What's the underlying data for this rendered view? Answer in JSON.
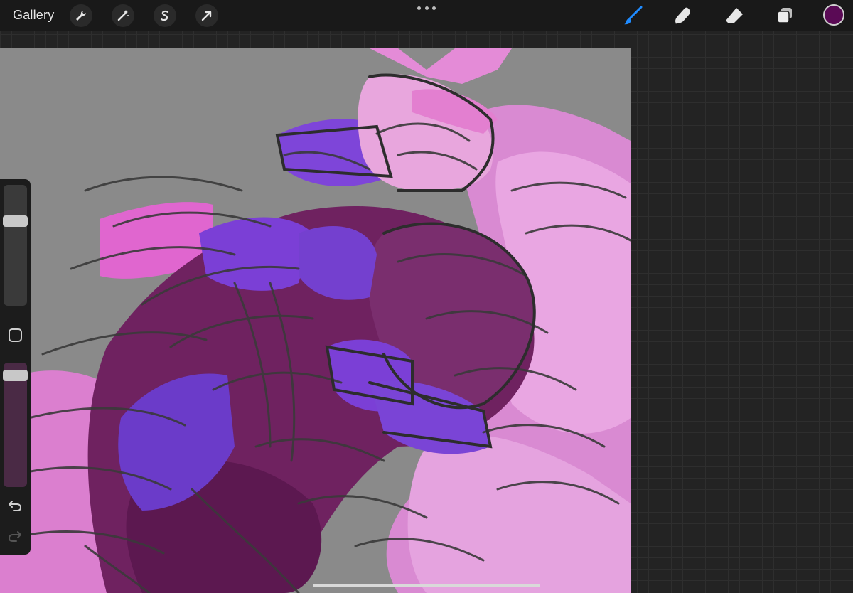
{
  "app": {
    "gallery_label": "Gallery"
  },
  "toolbar_left": [
    {
      "name": "actions",
      "icon": "wrench-icon"
    },
    {
      "name": "adjustments",
      "icon": "magic-wand-icon"
    },
    {
      "name": "selection",
      "icon": "selection-s-icon"
    },
    {
      "name": "transform",
      "icon": "arrow-cursor-icon"
    }
  ],
  "toolbar_right": [
    {
      "name": "brush",
      "icon": "brush-icon",
      "active": true,
      "color": "#1f8bff"
    },
    {
      "name": "smudge",
      "icon": "smudge-finger-icon"
    },
    {
      "name": "eraser",
      "icon": "eraser-icon"
    },
    {
      "name": "layers",
      "icon": "layers-icon"
    }
  ],
  "current_color": "#5a0a55",
  "sidebar": {
    "brush_size_level": 0.72,
    "opacity_level": 0.94,
    "undo_icon": "undo-icon",
    "redo_icon": "redo-icon"
  },
  "palette": {
    "canvas_bg": "#8a8a8a",
    "pink_light": "#e08fd6",
    "pink_mid": "#d470c8",
    "magenta": "#c43aa8",
    "plum": "#6b1e5e",
    "violet": "#7b3fd6",
    "sketch": "#3a3a3a"
  }
}
